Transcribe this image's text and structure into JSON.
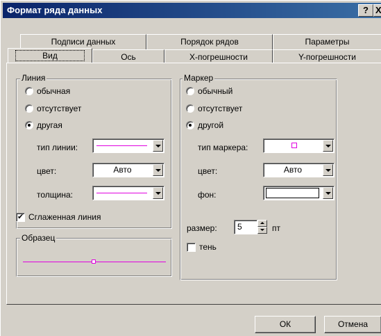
{
  "window": {
    "title": "Формат ряда данных",
    "help_label": "?",
    "close_label": "X"
  },
  "tabs": {
    "row1": [
      "Подписи данных",
      "Порядок рядов",
      "Параметры"
    ],
    "row2": [
      "Вид",
      "Ось",
      "Х-погрешности",
      "Y-погрешности"
    ],
    "selected": "Вид"
  },
  "line_group": {
    "title": "Линия",
    "radio_normal": "обычная",
    "radio_none": "отсутствует",
    "radio_custom": "другая",
    "selected": "другая",
    "style_label": "тип линии:",
    "color_label": "цвет:",
    "color_value": "Авто",
    "weight_label": "толщина:",
    "smooth_label": "Сглаженная линия",
    "smooth_checked": true,
    "line_color": "#e000e0"
  },
  "sample_group": {
    "title": "Образец"
  },
  "marker_group": {
    "title": "Маркер",
    "radio_normal": "обычный",
    "radio_none": "отсутствует",
    "radio_custom": "другой",
    "selected": "другой",
    "style_label": "тип маркера:",
    "color_label": "цвет:",
    "color_value": "Авто",
    "fill_label": "фон:",
    "size_label": "размер:",
    "size_value": "5",
    "size_unit": "пт",
    "shadow_label": "тень",
    "shadow_checked": false
  },
  "buttons": {
    "ok": "ОК",
    "cancel": "Отмена"
  }
}
